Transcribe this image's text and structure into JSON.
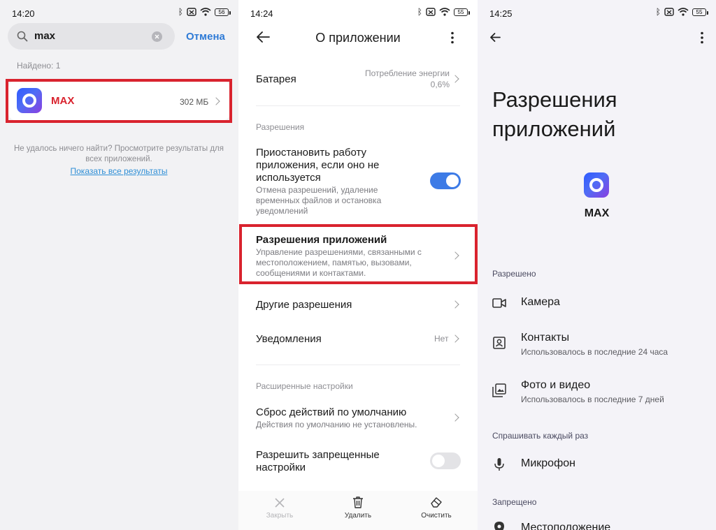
{
  "panel1": {
    "status": {
      "time": "14:20",
      "battery": "56"
    },
    "search": {
      "value": "max"
    },
    "cancel_label": "Отмена",
    "found_label": "Найдено: 1",
    "result": {
      "name": "MAX",
      "size": "302 МБ"
    },
    "no_result_text": "Не удалось ничего найти? Просмотрите результаты для всех приложений.",
    "show_all_label": "Показать все результаты"
  },
  "panel2": {
    "status": {
      "time": "14:24",
      "battery": "55"
    },
    "title": "О приложении",
    "battery_row": {
      "title": "Батарея",
      "value_line1": "Потребление энергии",
      "value_line2": "0,6%"
    },
    "section_permissions": "Разрешения",
    "pause_row": {
      "title": "Приостановить работу приложения, если оно не используется",
      "sub": "Отмена разрешений, удаление временных файлов и остановка уведомлений"
    },
    "app_permissions_row": {
      "title": "Разрешения приложений",
      "sub": "Управление разрешениями, связанными с местоположением, памятью, вызовами, сообщениями и контактами."
    },
    "other_permissions_row": {
      "title": "Другие разрешения"
    },
    "notifications_row": {
      "title": "Уведомления",
      "value": "Нет"
    },
    "section_advanced": "Расширенные настройки",
    "reset_row": {
      "title": "Сброс действий по умолчанию",
      "sub": "Действия по умолчанию не установлены."
    },
    "restricted_row": {
      "title": "Разрешить запрещенные настройки"
    },
    "bottom": {
      "close": "Закрыть",
      "delete": "Удалить",
      "clear": "Очистить"
    },
    "colors": {
      "toggle_on": "#3d7be6",
      "toggle_off": "#e3e3e6"
    }
  },
  "panel3": {
    "status": {
      "time": "14:25",
      "battery": "55"
    },
    "title": "Разрешения приложений",
    "app_name": "MAX",
    "section_allowed": "Разрешено",
    "camera": "Камера",
    "contacts": {
      "title": "Контакты",
      "sub": "Использовалось в последние 24 часа"
    },
    "photos": {
      "title": "Фото и видео",
      "sub": "Использовалось в последние 7 дней"
    },
    "section_ask": "Спрашивать каждый раз",
    "microphone": "Микрофон",
    "section_denied": "Запрещено",
    "location": "Местоположение"
  },
  "accent_red": "#d9232e"
}
